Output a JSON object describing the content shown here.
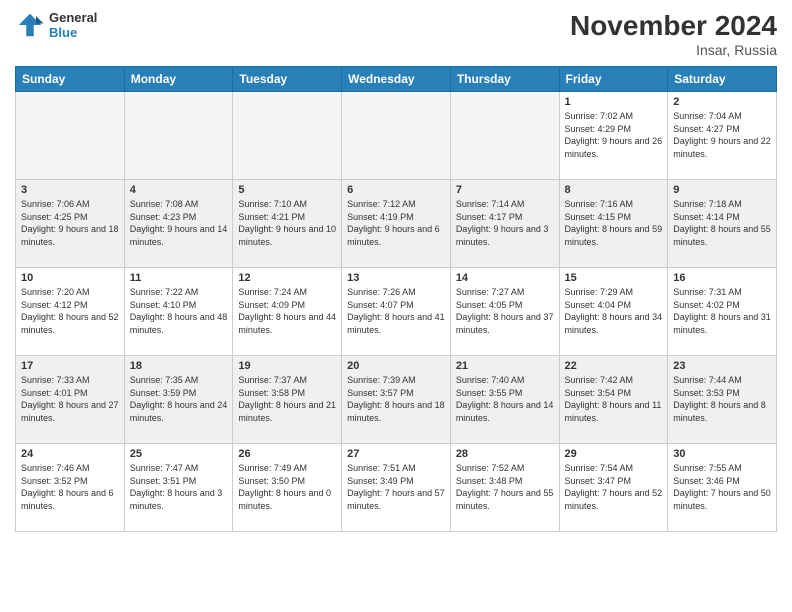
{
  "header": {
    "logo": {
      "general": "General",
      "blue": "Blue"
    },
    "title": "November 2024",
    "location": "Insar, Russia"
  },
  "days_of_week": [
    "Sunday",
    "Monday",
    "Tuesday",
    "Wednesday",
    "Thursday",
    "Friday",
    "Saturday"
  ],
  "weeks": [
    [
      {
        "day": "",
        "info": ""
      },
      {
        "day": "",
        "info": ""
      },
      {
        "day": "",
        "info": ""
      },
      {
        "day": "",
        "info": ""
      },
      {
        "day": "",
        "info": ""
      },
      {
        "day": "1",
        "info": "Sunrise: 7:02 AM\nSunset: 4:29 PM\nDaylight: 9 hours and 26 minutes."
      },
      {
        "day": "2",
        "info": "Sunrise: 7:04 AM\nSunset: 4:27 PM\nDaylight: 9 hours and 22 minutes."
      }
    ],
    [
      {
        "day": "3",
        "info": "Sunrise: 7:06 AM\nSunset: 4:25 PM\nDaylight: 9 hours and 18 minutes."
      },
      {
        "day": "4",
        "info": "Sunrise: 7:08 AM\nSunset: 4:23 PM\nDaylight: 9 hours and 14 minutes."
      },
      {
        "day": "5",
        "info": "Sunrise: 7:10 AM\nSunset: 4:21 PM\nDaylight: 9 hours and 10 minutes."
      },
      {
        "day": "6",
        "info": "Sunrise: 7:12 AM\nSunset: 4:19 PM\nDaylight: 9 hours and 6 minutes."
      },
      {
        "day": "7",
        "info": "Sunrise: 7:14 AM\nSunset: 4:17 PM\nDaylight: 9 hours and 3 minutes."
      },
      {
        "day": "8",
        "info": "Sunrise: 7:16 AM\nSunset: 4:15 PM\nDaylight: 8 hours and 59 minutes."
      },
      {
        "day": "9",
        "info": "Sunrise: 7:18 AM\nSunset: 4:14 PM\nDaylight: 8 hours and 55 minutes."
      }
    ],
    [
      {
        "day": "10",
        "info": "Sunrise: 7:20 AM\nSunset: 4:12 PM\nDaylight: 8 hours and 52 minutes."
      },
      {
        "day": "11",
        "info": "Sunrise: 7:22 AM\nSunset: 4:10 PM\nDaylight: 8 hours and 48 minutes."
      },
      {
        "day": "12",
        "info": "Sunrise: 7:24 AM\nSunset: 4:09 PM\nDaylight: 8 hours and 44 minutes."
      },
      {
        "day": "13",
        "info": "Sunrise: 7:26 AM\nSunset: 4:07 PM\nDaylight: 8 hours and 41 minutes."
      },
      {
        "day": "14",
        "info": "Sunrise: 7:27 AM\nSunset: 4:05 PM\nDaylight: 8 hours and 37 minutes."
      },
      {
        "day": "15",
        "info": "Sunrise: 7:29 AM\nSunset: 4:04 PM\nDaylight: 8 hours and 34 minutes."
      },
      {
        "day": "16",
        "info": "Sunrise: 7:31 AM\nSunset: 4:02 PM\nDaylight: 8 hours and 31 minutes."
      }
    ],
    [
      {
        "day": "17",
        "info": "Sunrise: 7:33 AM\nSunset: 4:01 PM\nDaylight: 8 hours and 27 minutes."
      },
      {
        "day": "18",
        "info": "Sunrise: 7:35 AM\nSunset: 3:59 PM\nDaylight: 8 hours and 24 minutes."
      },
      {
        "day": "19",
        "info": "Sunrise: 7:37 AM\nSunset: 3:58 PM\nDaylight: 8 hours and 21 minutes."
      },
      {
        "day": "20",
        "info": "Sunrise: 7:39 AM\nSunset: 3:57 PM\nDaylight: 8 hours and 18 minutes."
      },
      {
        "day": "21",
        "info": "Sunrise: 7:40 AM\nSunset: 3:55 PM\nDaylight: 8 hours and 14 minutes."
      },
      {
        "day": "22",
        "info": "Sunrise: 7:42 AM\nSunset: 3:54 PM\nDaylight: 8 hours and 11 minutes."
      },
      {
        "day": "23",
        "info": "Sunrise: 7:44 AM\nSunset: 3:53 PM\nDaylight: 8 hours and 8 minutes."
      }
    ],
    [
      {
        "day": "24",
        "info": "Sunrise: 7:46 AM\nSunset: 3:52 PM\nDaylight: 8 hours and 6 minutes."
      },
      {
        "day": "25",
        "info": "Sunrise: 7:47 AM\nSunset: 3:51 PM\nDaylight: 8 hours and 3 minutes."
      },
      {
        "day": "26",
        "info": "Sunrise: 7:49 AM\nSunset: 3:50 PM\nDaylight: 8 hours and 0 minutes."
      },
      {
        "day": "27",
        "info": "Sunrise: 7:51 AM\nSunset: 3:49 PM\nDaylight: 7 hours and 57 minutes."
      },
      {
        "day": "28",
        "info": "Sunrise: 7:52 AM\nSunset: 3:48 PM\nDaylight: 7 hours and 55 minutes."
      },
      {
        "day": "29",
        "info": "Sunrise: 7:54 AM\nSunset: 3:47 PM\nDaylight: 7 hours and 52 minutes."
      },
      {
        "day": "30",
        "info": "Sunrise: 7:55 AM\nSunset: 3:46 PM\nDaylight: 7 hours and 50 minutes."
      }
    ]
  ]
}
